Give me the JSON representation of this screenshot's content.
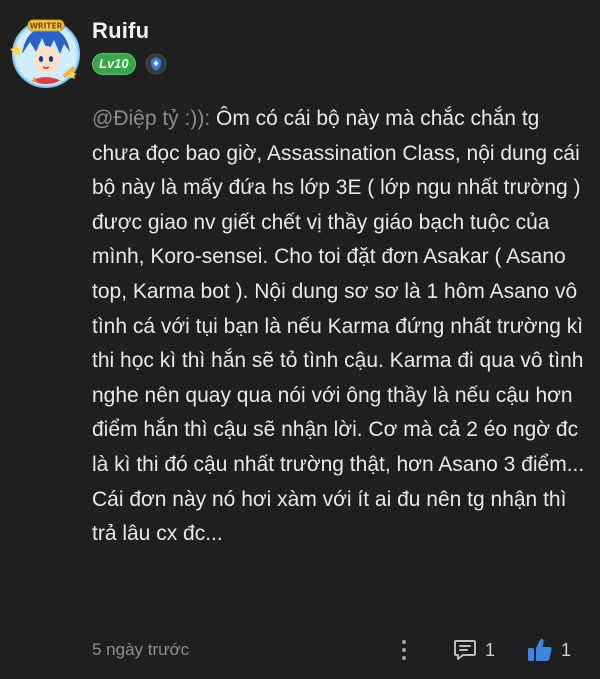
{
  "comment": {
    "author": "Ruifu",
    "level": "Lv10",
    "mention": "@Điệp tỷ :)):",
    "text": " Ôm có cái bộ này mà chắc chắn tg chưa đọc bao giờ, Assassination Class, nội dung cái bộ này là mấy đứa hs lớp 3E ( lớp ngu nhất trường ) được giao nv giết chết vị thầy giáo bạch tuộc của mình, Koro-sensei. Cho toi đặt đơn Asakar ( Asano top, Karma bot ). Nội dung sơ sơ là 1 hôm Asano vô tình cá với tụi bạn là nếu Karma đứng nhất trường kì thi học kì thì hắn sẽ tỏ tình cậu. Karma đi qua vô tình nghe nên quay qua nói với ông thầy là nếu cậu hơn điểm hắn thì cậu sẽ nhận lời. Cơ mà cả 2 éo ngờ đc là kì thi đó cậu nhất trường thật, hơn Asano 3 điểm... Cái đơn này nó hơi xàm với ít ai đu nên tg nhận thì trả lâu cx đc...",
    "timestamp": "5 ngày trước",
    "reply_count": "1",
    "like_count": "1"
  },
  "avatar_badge_text": "WRITER",
  "icons": {
    "avatar": "avatar-image",
    "verify": "verified-shield-icon",
    "more": "more-vertical-icon",
    "reply": "comment-reply-icon",
    "like": "thumbs-up-icon"
  },
  "colors": {
    "background": "#1f1f1f",
    "level_badge": "#39a64c",
    "verify_badge": "#3b7bd8",
    "like_icon": "#3f86e0",
    "muted_text": "#8e8e8e"
  }
}
